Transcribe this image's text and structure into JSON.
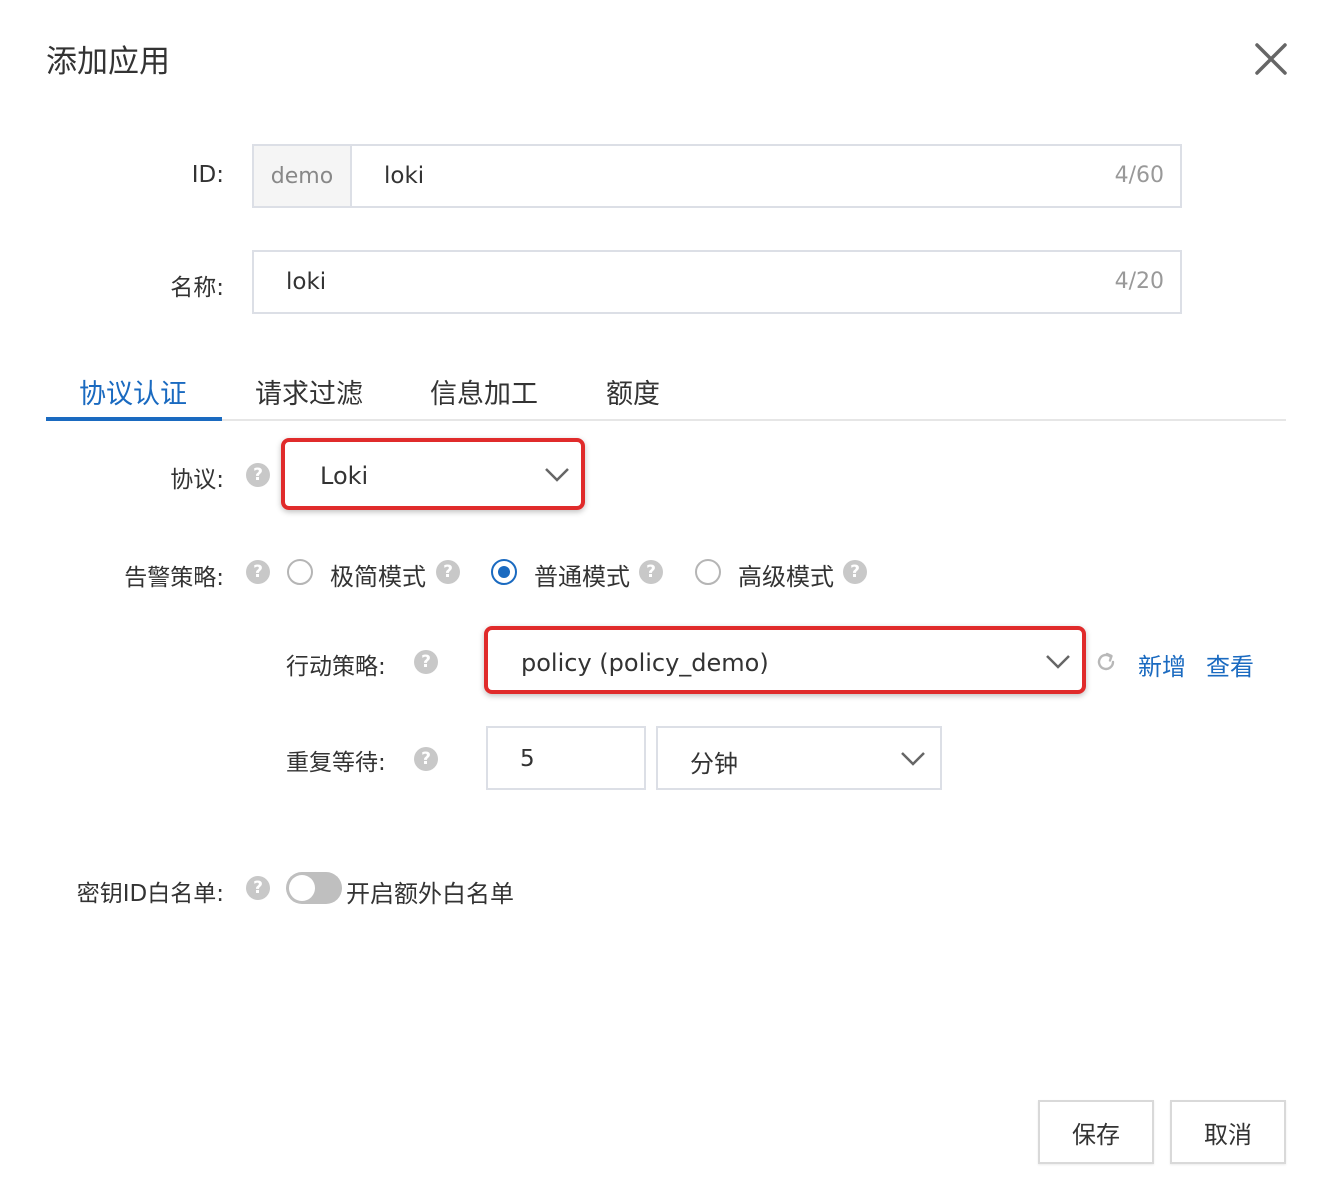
{
  "dialog": {
    "title": "添加应用",
    "close_icon": "close-icon"
  },
  "form": {
    "id": {
      "label": "ID:",
      "prefix": "demo",
      "value": "loki",
      "counter": "4/60"
    },
    "name": {
      "label": "名称:",
      "value": "loki",
      "counter": "4/20"
    }
  },
  "tabs": [
    {
      "label": "协议认证",
      "active": true
    },
    {
      "label": "请求过滤",
      "active": false
    },
    {
      "label": "信息加工",
      "active": false
    },
    {
      "label": "额度",
      "active": false
    }
  ],
  "protocol": {
    "label": "协议:",
    "selected": "Loki"
  },
  "alert_policy": {
    "label": "告警策略:",
    "options": [
      {
        "label": "极简模式",
        "checked": false
      },
      {
        "label": "普通模式",
        "checked": true
      },
      {
        "label": "高级模式",
        "checked": false
      }
    ]
  },
  "action_policy": {
    "label": "行动策略:",
    "selected": "policy (policy_demo)",
    "add_label": "新增",
    "view_label": "查看"
  },
  "repeat_wait": {
    "label": "重复等待:",
    "value": "5",
    "unit": "分钟"
  },
  "key_whitelist": {
    "label": "密钥ID白名单:",
    "toggle_label": "开启额外白名单",
    "enabled": false
  },
  "footer": {
    "save_label": "保存",
    "cancel_label": "取消"
  },
  "colors": {
    "accent": "#1a6ac0",
    "highlight": "#e02b2b",
    "help": "#c8c8c8"
  },
  "help_symbol": "?"
}
